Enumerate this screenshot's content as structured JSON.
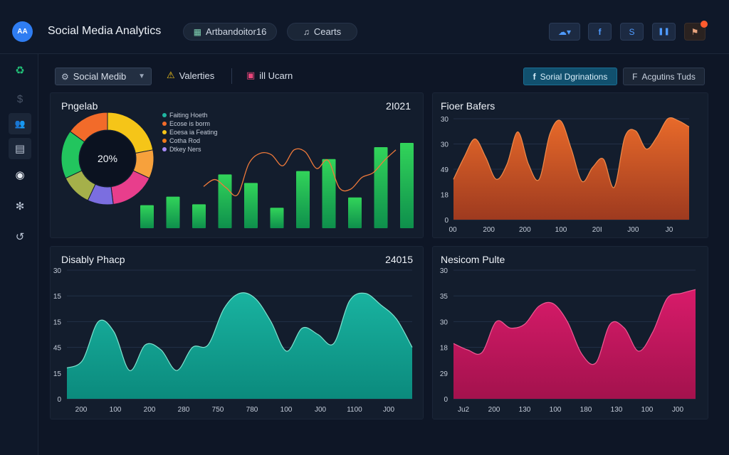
{
  "header": {
    "logo_text": "AA",
    "title": "Social Media Analytics",
    "pill_1": {
      "icon": "grid-icon",
      "label": "Artbandoitor16"
    },
    "pill_2": {
      "icon": "chart-icon",
      "label": "Cearts"
    },
    "toolbar": [
      {
        "name": "cloud-dropdown-button",
        "icon": "cloud-icon",
        "glyph": "☁▾"
      },
      {
        "name": "facebook-button",
        "icon": "facebook-icon",
        "glyph": "f"
      },
      {
        "name": "skype-button",
        "icon": "skype-icon",
        "glyph": "S"
      },
      {
        "name": "pause-button",
        "icon": "pause-icon",
        "glyph": "❚❚"
      },
      {
        "name": "notifications-button",
        "icon": "notification-icon",
        "glyph": "⚑"
      }
    ]
  },
  "sidebar": {
    "items": [
      {
        "name": "sidebar-item-recycle",
        "icon": "recycle-icon",
        "glyph": "♻",
        "color": "#22c47a"
      },
      {
        "name": "sidebar-item-currency",
        "icon": "currency-icon",
        "glyph": "$",
        "color": "#4a5568"
      },
      {
        "name": "sidebar-item-users",
        "icon": "users-icon",
        "glyph": "👥",
        "color": "#b9c3d3"
      },
      {
        "name": "sidebar-item-documents",
        "icon": "documents-icon",
        "glyph": "▤",
        "color": "#b9c3d3"
      },
      {
        "name": "sidebar-item-chat",
        "icon": "chat-icon",
        "glyph": "◉",
        "color": "#e6ebf2"
      },
      {
        "name": "sidebar-item-network",
        "icon": "network-icon",
        "glyph": "✻",
        "color": "#b9c3d3"
      },
      {
        "name": "sidebar-item-history",
        "icon": "history-icon",
        "glyph": "↺",
        "color": "#b9c3d3"
      }
    ]
  },
  "filters": {
    "select_label": "Social Medib",
    "item_1": {
      "icon": "warning-icon",
      "label": "Valerties"
    },
    "item_2": {
      "icon": "instagram-icon",
      "label": "ill Ucarn"
    },
    "primary_button": "Sorial Dgrinations",
    "secondary_button": "Acgutins Tuds"
  },
  "colors": {
    "accent": "#2f7df2",
    "green_bar": "#22c55e",
    "orange_area": "#e0622a",
    "teal_area": "#15a493",
    "magenta_area": "#c2185b"
  },
  "chart_data": [
    {
      "id": "panel_1",
      "type": "donut+bar",
      "title": "Pngelab",
      "headline_value": "2I021",
      "donut": {
        "center_label": "20%",
        "slices": [
          {
            "value": 22,
            "color": "#f5c518"
          },
          {
            "value": 10,
            "color": "#f7a13c"
          },
          {
            "value": 16,
            "color": "#e83e8c"
          },
          {
            "value": 9,
            "color": "#7b6ee0"
          },
          {
            "value": 11,
            "color": "#a5b04a"
          },
          {
            "value": 17,
            "color": "#22c55e"
          },
          {
            "value": 15,
            "color": "#f26b2a"
          }
        ]
      },
      "legend": [
        {
          "label": "Faiting Hoeth",
          "color": "#1fb5a0"
        },
        {
          "label": "Ecose is borm",
          "color": "#f26b2a"
        },
        {
          "label": "Eoesa ia Feating",
          "color": "#f5c518"
        },
        {
          "label": "Cotha Rod",
          "color": "#f07a1a"
        },
        {
          "label": "Dtkey Ners",
          "color": "#a78bfa"
        }
      ],
      "bars": [
        0.27,
        0.37,
        0.28,
        0.63,
        0.53,
        0.24,
        0.67,
        0.81,
        0.36,
        0.95,
        1.0
      ],
      "line": [
        0.42,
        0.52,
        0.4,
        0.3,
        0.75,
        0.9,
        0.88,
        0.72,
        0.95,
        0.92,
        0.68,
        0.8,
        0.4,
        0.38,
        0.55,
        0.62,
        0.8,
        0.95
      ]
    },
    {
      "id": "panel_2",
      "type": "area",
      "title": "Fioer Bafers",
      "y_ticks": [
        "30",
        "30",
        "49",
        "18",
        "0"
      ],
      "x_ticks": [
        "00",
        "200",
        "200",
        "100",
        "20I",
        "J00",
        "J0"
      ],
      "values": [
        0.4,
        0.62,
        0.8,
        0.62,
        0.4,
        0.55,
        0.87,
        0.55,
        0.4,
        0.85,
        0.98,
        0.7,
        0.38,
        0.52,
        0.6,
        0.32,
        0.82,
        0.88,
        0.7,
        0.82,
        1.0,
        0.98,
        0.92
      ],
      "color": "#e0622a"
    },
    {
      "id": "panel_3",
      "type": "area",
      "title": "Disably Phacp",
      "headline_value": "24015",
      "y_ticks": [
        "30",
        "15",
        "15",
        "45",
        "15",
        "0"
      ],
      "x_ticks": [
        "200",
        "100",
        "200",
        "280",
        "750",
        "780",
        "100",
        "J00",
        "1100",
        "J00"
      ],
      "values": [
        0.24,
        0.3,
        0.6,
        0.52,
        0.22,
        0.42,
        0.38,
        0.22,
        0.4,
        0.42,
        0.7,
        0.82,
        0.78,
        0.6,
        0.37,
        0.55,
        0.5,
        0.43,
        0.76,
        0.82,
        0.73,
        0.62,
        0.4
      ],
      "color": "#15a493"
    },
    {
      "id": "panel_4",
      "type": "area",
      "title": "Nesicom Pulte",
      "y_ticks": [
        "30",
        "35",
        "30",
        "18",
        "29",
        "0"
      ],
      "x_ticks": [
        "Ju2",
        "200",
        "130",
        "100",
        "180",
        "130",
        "100",
        "J00"
      ],
      "values": [
        0.43,
        0.38,
        0.36,
        0.6,
        0.55,
        0.58,
        0.72,
        0.74,
        0.6,
        0.35,
        0.28,
        0.58,
        0.55,
        0.37,
        0.52,
        0.78,
        0.82,
        0.85
      ],
      "color": "#c2185b"
    }
  ]
}
